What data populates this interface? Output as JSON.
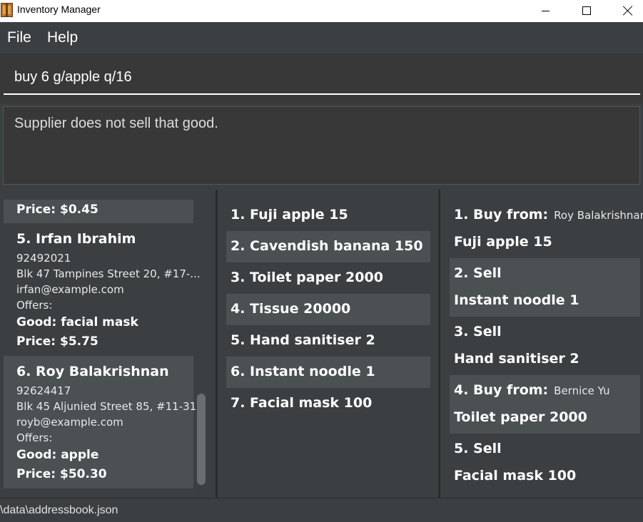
{
  "window": {
    "title": "Inventory Manager"
  },
  "menu": {
    "file": "File",
    "help": "Help"
  },
  "command": {
    "value": "buy 6 g/apple q/16"
  },
  "result": {
    "message": "Supplier does not sell that good."
  },
  "suppliers": {
    "partial_price": "Price: $0.45",
    "items": [
      {
        "name": "5.  Irfan Ibrahim",
        "phone": "92492021",
        "address": "Blk 47 Tampines Street 20, #17-...",
        "email": "irfan@example.com",
        "offers": "Offers:",
        "good": "Good: facial mask",
        "price": "Price: $5.75"
      },
      {
        "name": "6.  Roy Balakrishnan",
        "phone": "92624417",
        "address": "Blk 45 Aljunied Street 85, #11-31",
        "email": "royb@example.com",
        "offers": "Offers:",
        "good": "Good: apple",
        "price": "Price: $50.30"
      }
    ]
  },
  "inventory": {
    "items": [
      {
        "label": "1.  Fuji apple 15"
      },
      {
        "label": "2.  Cavendish banana 150"
      },
      {
        "label": "3.  Toilet paper 2000"
      },
      {
        "label": "4.  Tissue 20000"
      },
      {
        "label": "5.  Hand sanitiser 2"
      },
      {
        "label": "6.  Instant noodle 1"
      },
      {
        "label": "7.  Facial mask 100"
      }
    ]
  },
  "transactions": {
    "items": [
      {
        "head": "1.  Buy from:",
        "who": "Roy Balakrishnan",
        "item": "Fuji apple 15"
      },
      {
        "head": "2.  Sell",
        "who": "",
        "item": "Instant noodle 1"
      },
      {
        "head": "3.  Sell",
        "who": "",
        "item": "Hand sanitiser 2"
      },
      {
        "head": "4.  Buy from:",
        "who": "Bernice Yu",
        "item": "Toilet paper 2000"
      },
      {
        "head": "5.  Sell",
        "who": "",
        "item": "Facial mask 100"
      }
    ]
  },
  "status": {
    "path": "\\data\\addressbook.json"
  }
}
